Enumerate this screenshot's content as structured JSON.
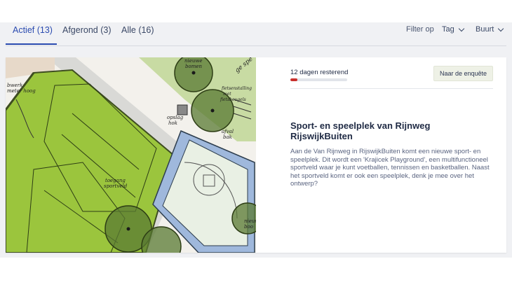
{
  "tabs": [
    {
      "label": "Actief (13)",
      "active": true
    },
    {
      "label": "Afgerond (3)",
      "active": false
    },
    {
      "label": "Alle (16)",
      "active": false
    }
  ],
  "filters": {
    "label": "Filter op",
    "tag": "Tag",
    "neighbourhood": "Buurt"
  },
  "card": {
    "remaining": "12 dagen resterend",
    "progress_fraction": 0.12,
    "button_label": "Naar de enquête",
    "title": "Sport- en speelplek van Rijnweg RijswijkBuiten",
    "description": "Aan de Van Rijnweg in RijswijkBuiten komt een nieuwe sport- en speelplek. Dit wordt een 'Krajicek Playground', een multifunctioneel sportveld waar je kunt voetballen, tennissen en basketballen. Naast het sportveld komt er ook een speelplek, denk je mee over het ontwerp?",
    "map_labels": {
      "trees1": "nieuwe",
      "trees2": "bomen",
      "edge": "ge spe",
      "fence1": "bwerk",
      "fence2": "meter hoog",
      "bench1": "fietsenstalling",
      "bench2": "met",
      "bench3": "fietsbeugels",
      "store1": "opslag",
      "store2": "hok",
      "waste1": "afval",
      "waste2": "bak",
      "field1": "toegang",
      "field2": "sportveld",
      "newtrees1": "nieuw",
      "newtrees2": "boo"
    }
  },
  "colors": {
    "accent": "#2a4bb0",
    "progress": "#c9302c",
    "field_green": "#9bc53d",
    "court_blue": "#9fb8dc"
  }
}
